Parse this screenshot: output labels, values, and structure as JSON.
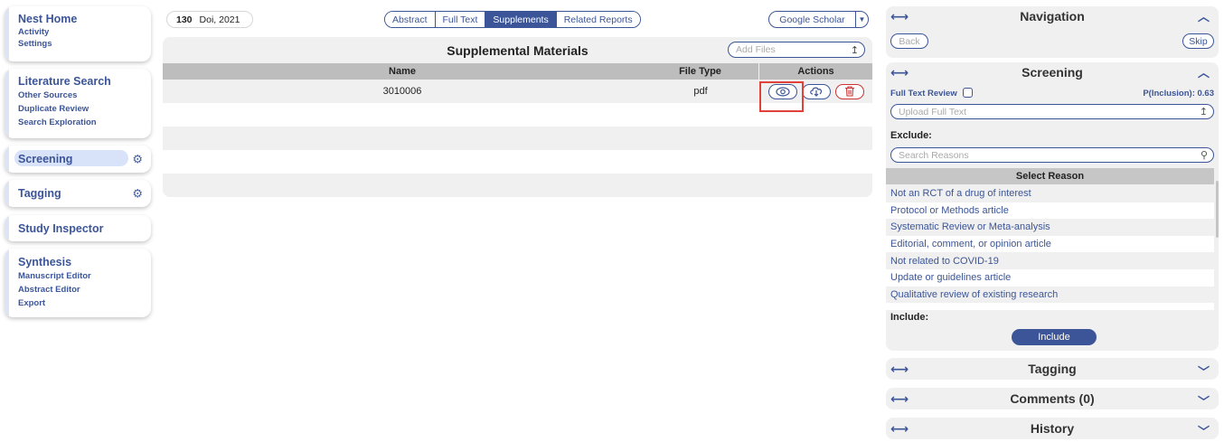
{
  "sidebar": {
    "nest": {
      "title": "Nest Home",
      "items": [
        "Activity",
        "Settings"
      ]
    },
    "literature": {
      "title": "Literature Search",
      "items": [
        "Other Sources",
        "Duplicate Review",
        "Search Exploration"
      ]
    },
    "screening": {
      "title": "Screening"
    },
    "tagging": {
      "title": "Tagging"
    },
    "inspector": {
      "title": "Study Inspector"
    },
    "synthesis": {
      "title": "Synthesis",
      "items": [
        "Manuscript Editor",
        "Abstract Editor",
        "Export"
      ]
    }
  },
  "record": {
    "id": "130",
    "doi": "Doi, 2021"
  },
  "tabs": [
    "Abstract",
    "Full Text",
    "Supplements",
    "Related Reports"
  ],
  "active_tab": "Supplements",
  "scholar": {
    "label": "Google Scholar"
  },
  "supplements": {
    "title": "Supplemental Materials",
    "add_placeholder": "Add Files",
    "columns": [
      "Name",
      "File Type",
      "Actions"
    ],
    "rows": [
      {
        "name": "3010006",
        "type": "pdf"
      }
    ]
  },
  "navigation": {
    "title": "Navigation",
    "back": "Back",
    "skip": "Skip"
  },
  "screening": {
    "title": "Screening",
    "full_text_review": "Full Text Review",
    "p_inclusion": "P(Inclusion): 0.63",
    "upload_placeholder": "Upload Full Text",
    "exclude_label": "Exclude:",
    "search_placeholder": "Search Reasons",
    "select_reason": "Select Reason",
    "reasons": [
      "Not an RCT of a drug of interest",
      "Protocol or Methods article",
      "Systematic Review or Meta-analysis",
      "Editorial, comment, or opinion article",
      "Not related to COVID-19",
      "Update or guidelines article",
      "Qualitative review of existing research"
    ],
    "include_label": "Include:",
    "include_button": "Include"
  },
  "panels": {
    "tagging": "Tagging",
    "comments": "Comments (0)",
    "history": "History"
  },
  "colors": {
    "accent": "#3b5598",
    "highlight": "#e0413a",
    "danger": "#cc3333"
  }
}
